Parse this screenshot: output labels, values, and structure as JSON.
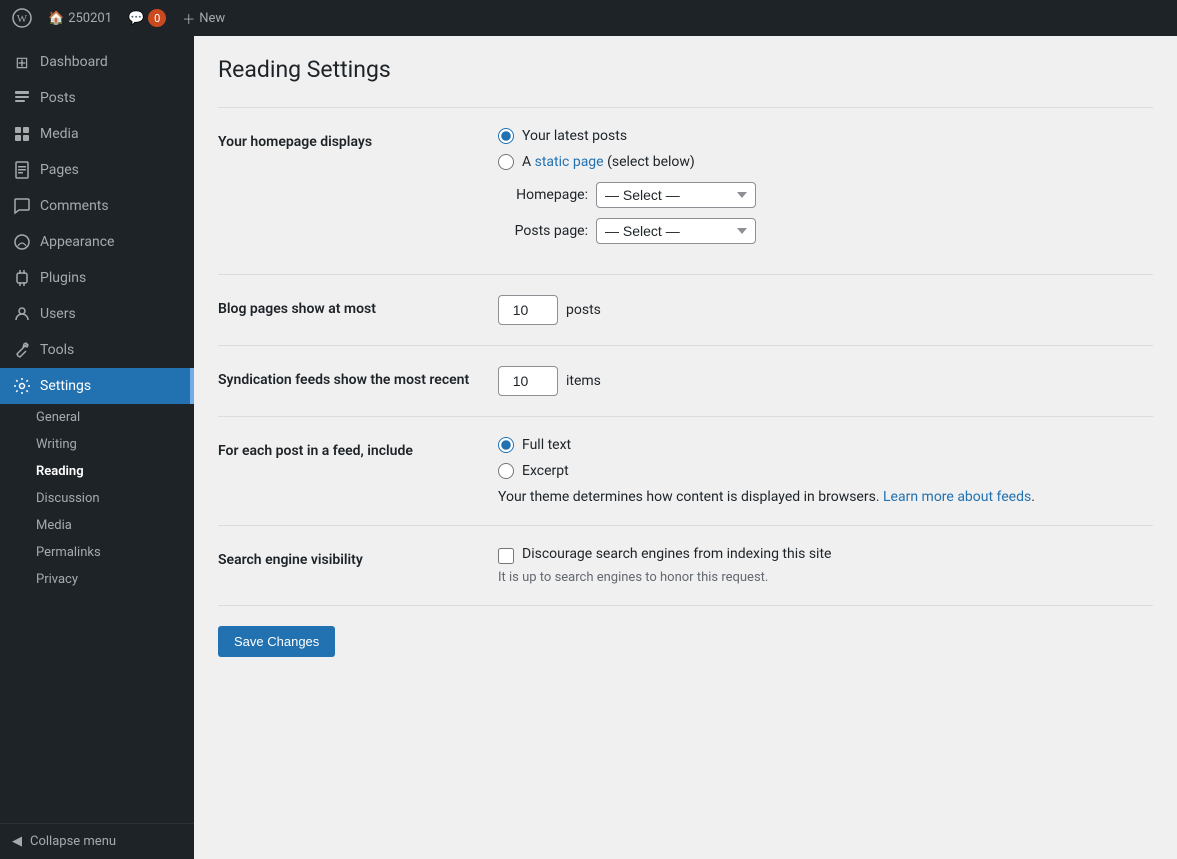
{
  "topbar": {
    "site_name": "250201",
    "comments_count": "0",
    "new_label": "New",
    "wp_logo": "⊞"
  },
  "sidebar": {
    "items": [
      {
        "id": "dashboard",
        "label": "Dashboard",
        "icon": "⊞"
      },
      {
        "id": "posts",
        "label": "Posts",
        "icon": "📄"
      },
      {
        "id": "media",
        "label": "Media",
        "icon": "🖼"
      },
      {
        "id": "pages",
        "label": "Pages",
        "icon": "📋"
      },
      {
        "id": "comments",
        "label": "Comments",
        "icon": "💬"
      },
      {
        "id": "appearance",
        "label": "Appearance",
        "icon": "🎨"
      },
      {
        "id": "plugins",
        "label": "Plugins",
        "icon": "🔌"
      },
      {
        "id": "users",
        "label": "Users",
        "icon": "👤"
      },
      {
        "id": "tools",
        "label": "Tools",
        "icon": "🔧"
      },
      {
        "id": "settings",
        "label": "Settings",
        "icon": "⚙"
      }
    ],
    "settings_submenu": [
      {
        "id": "general",
        "label": "General"
      },
      {
        "id": "writing",
        "label": "Writing"
      },
      {
        "id": "reading",
        "label": "Reading",
        "active": true
      },
      {
        "id": "discussion",
        "label": "Discussion"
      },
      {
        "id": "media",
        "label": "Media"
      },
      {
        "id": "permalinks",
        "label": "Permalinks"
      },
      {
        "id": "privacy",
        "label": "Privacy"
      }
    ],
    "collapse_label": "Collapse menu"
  },
  "main": {
    "page_title": "Reading Settings",
    "homepage_displays": {
      "label": "Your homepage displays",
      "option_latest": "Your latest posts",
      "option_static": "A",
      "static_page_link": "static page",
      "static_page_suffix": "(select below)",
      "homepage_label": "Homepage:",
      "homepage_placeholder": "— Select —",
      "posts_page_label": "Posts page:",
      "posts_page_placeholder": "— Select —"
    },
    "blog_pages": {
      "label": "Blog pages show at most",
      "value": "10",
      "unit": "posts"
    },
    "syndication_feeds": {
      "label": "Syndication feeds show the most recent",
      "value": "10",
      "unit": "items"
    },
    "feed_content": {
      "label": "For each post in a feed, include",
      "option_full": "Full text",
      "option_excerpt": "Excerpt",
      "description": "Your theme determines how content is displayed in browsers.",
      "learn_more_text": "Learn more about feeds",
      "learn_more_url": "#"
    },
    "search_visibility": {
      "label": "Search engine visibility",
      "checkbox_label": "Discourage search engines from indexing this site",
      "help_text": "It is up to search engines to honor this request."
    },
    "save_button": "Save Changes"
  }
}
